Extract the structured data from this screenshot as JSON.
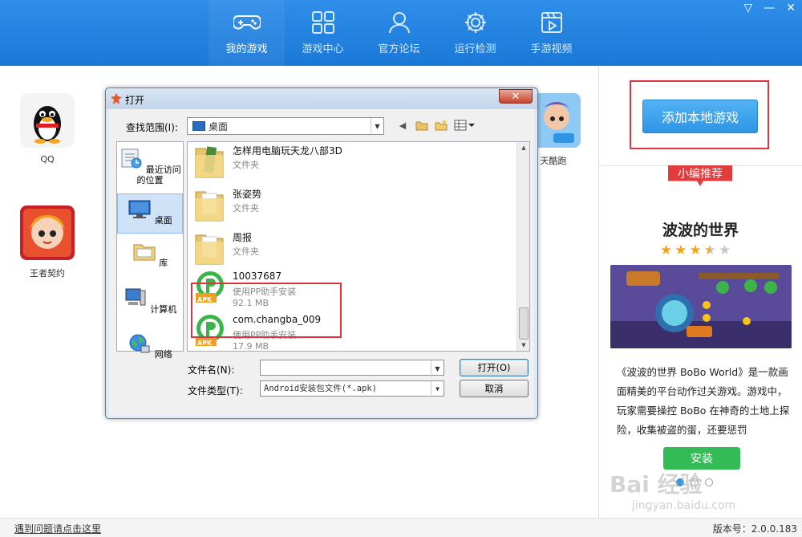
{
  "nav": {
    "items": [
      {
        "label": "我的游戏",
        "icon": "gamepad-icon",
        "active": true
      },
      {
        "label": "游戏中心",
        "icon": "grid-icon",
        "active": false
      },
      {
        "label": "官方论坛",
        "icon": "user-icon",
        "active": false
      },
      {
        "label": "运行检测",
        "icon": "gear-icon",
        "active": false
      },
      {
        "label": "手游视频",
        "icon": "video-icon",
        "active": false
      }
    ]
  },
  "window_controls": {
    "menu": "▽",
    "minimize": "—",
    "close": "✕"
  },
  "games": [
    {
      "label": "QQ"
    },
    {
      "label": "王者契约"
    },
    {
      "label": "天酷跑"
    }
  ],
  "sidebar": {
    "add_local_game": "添加本地游戏",
    "recommend_badge": "小编推荐",
    "reco_title": "波波的世界",
    "rating": 3.5,
    "rating_max": 5,
    "reco_desc": "《波波的世界 BoBo World》是一款画面精美的平台动作过关游戏。游戏中，玩家需要操控 BoBo 在神奇的土地上探险，收集被盗的蛋，还要惩罚",
    "install": "安装",
    "carousel_count": 3,
    "carousel_active": 0
  },
  "status": {
    "help_link": "遇到问题请点击这里",
    "version": "版本号：2.0.0.183"
  },
  "dialog": {
    "title": "打开",
    "close": "✕",
    "look_in_label": "查找范围(I):",
    "look_in_value": "桌面",
    "places": [
      {
        "label": "最近访问的位置"
      },
      {
        "label": "桌面",
        "selected": true
      },
      {
        "label": "库"
      },
      {
        "label": "计算机"
      },
      {
        "label": "网络"
      }
    ],
    "files": [
      {
        "name": "怎样用电脑玩天龙八部3D",
        "type": "文件夹",
        "size": "",
        "kind": "folder"
      },
      {
        "name": "张姿势",
        "type": "文件夹",
        "size": "",
        "kind": "folder"
      },
      {
        "name": "周报",
        "type": "文件夹",
        "size": "",
        "kind": "folder"
      },
      {
        "name": "10037687",
        "type": "使用PP助手安装",
        "size": "92.1 MB",
        "kind": "apk"
      },
      {
        "name": "com.changba_009",
        "type": "使用PP助手安装",
        "size": "17.9 MB",
        "kind": "apk"
      }
    ],
    "apk_label": "APK",
    "filename_label": "文件名(N):",
    "filename_value": "",
    "filetype_label": "文件类型(T):",
    "filetype_value": "Android安装包文件(*.apk)",
    "open_button": "打开(O)",
    "cancel_button": "取消"
  },
  "watermark": {
    "text": "Bai 经验",
    "sub": "jingyan.baidu.com"
  },
  "colors": {
    "accent": "#1a78d8",
    "highlight_box": "#d9363e",
    "install_green": "#33bb55",
    "pp_green": "#3bb54a"
  }
}
